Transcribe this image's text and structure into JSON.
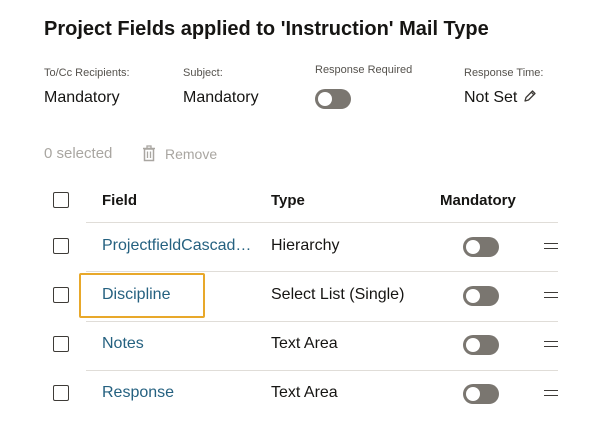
{
  "page": {
    "title": "Project Fields applied to 'Instruction' Mail Type"
  },
  "meta": {
    "recipients_label": "To/Cc Recipients:",
    "recipients_value": "Mandatory",
    "subject_label": "Subject:",
    "subject_value": "Mandatory",
    "response_required_label": "Response Required",
    "response_required_on": false,
    "response_time_label": "Response Time:",
    "response_time_value": "Not Set"
  },
  "toolbar": {
    "selected_text": "0 selected",
    "remove_label": "Remove"
  },
  "table": {
    "headers": {
      "field": "Field",
      "type": "Type",
      "mandatory": "Mandatory"
    },
    "rows": [
      {
        "field": "ProjectfieldCascad…",
        "type": "Hierarchy",
        "mandatory": false
      },
      {
        "field": "Discipline",
        "type": "Select List (Single)",
        "mandatory": false
      },
      {
        "field": "Notes",
        "type": "Text Area",
        "mandatory": false
      },
      {
        "field": "Response",
        "type": "Text Area",
        "mandatory": false
      }
    ]
  },
  "colors": {
    "link": "#256180",
    "toggle_off": "#7a7670",
    "highlight": "#e8a82a",
    "disabled_text": "#a9a6a1"
  },
  "icons": {
    "edit": "pencil-icon",
    "remove": "trash-icon",
    "row_handle": "drag-handle-icon"
  }
}
